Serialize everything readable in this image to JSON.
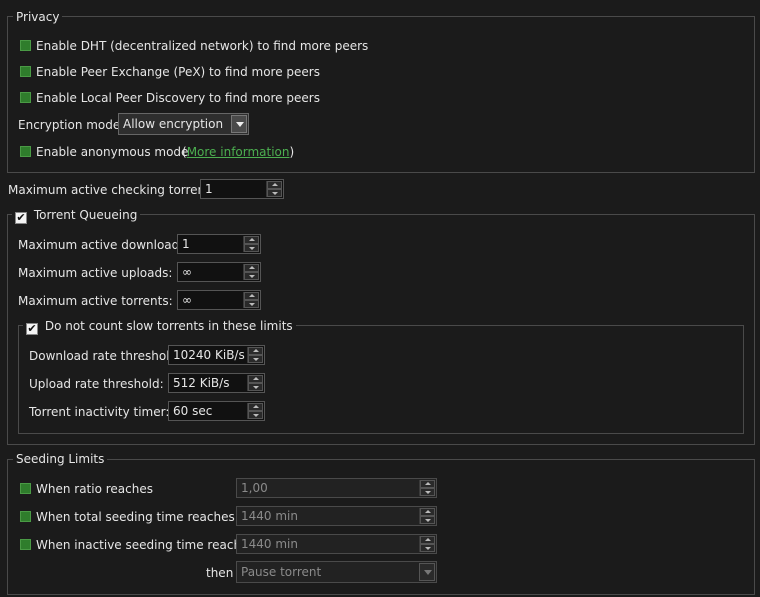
{
  "privacy": {
    "title": "Privacy",
    "dht_label": "Enable DHT (decentralized network) to find more peers",
    "pex_label": "Enable Peer Exchange (PeX) to find more peers",
    "lpd_label": "Enable Local Peer Discovery to find more peers",
    "encryption_label": "Encryption mode:",
    "encryption_value": "Allow encryption",
    "anon_label": "Enable anonymous mode",
    "more_info_open": "(",
    "more_info_link": "More information",
    "more_info_close": ")"
  },
  "checking": {
    "label": "Maximum active checking torrents:",
    "value": "1"
  },
  "queueing": {
    "title": "Torrent Queueing",
    "checked": true,
    "downloads_label": "Maximum active downloads:",
    "downloads_value": "1",
    "uploads_label": "Maximum active uploads:",
    "uploads_value": "∞",
    "torrents_label": "Maximum active torrents:",
    "torrents_value": "∞",
    "slow": {
      "title": "Do not count slow torrents in these limits",
      "checked": true,
      "download_label": "Download rate threshold:",
      "download_value": "10240 KiB/s",
      "upload_label": "Upload rate threshold:",
      "upload_value": "512 KiB/s",
      "inactivity_label": "Torrent inactivity timer:",
      "inactivity_value": "60 sec"
    }
  },
  "seeding": {
    "title": "Seeding Limits",
    "ratio_label": "When ratio reaches",
    "ratio_value": "1,00",
    "total_label": "When total seeding time reaches",
    "total_value": "1440 min",
    "inactive_label": "When inactive seeding time reaches",
    "inactive_value": "1440 min",
    "then_label": "then",
    "action_value": "Pause torrent"
  },
  "icons": {
    "checked_mark": "✔"
  },
  "colors": {
    "background": "#1b1b1b",
    "check_green": "#2f7d2c",
    "link_green": "#4caf50"
  }
}
